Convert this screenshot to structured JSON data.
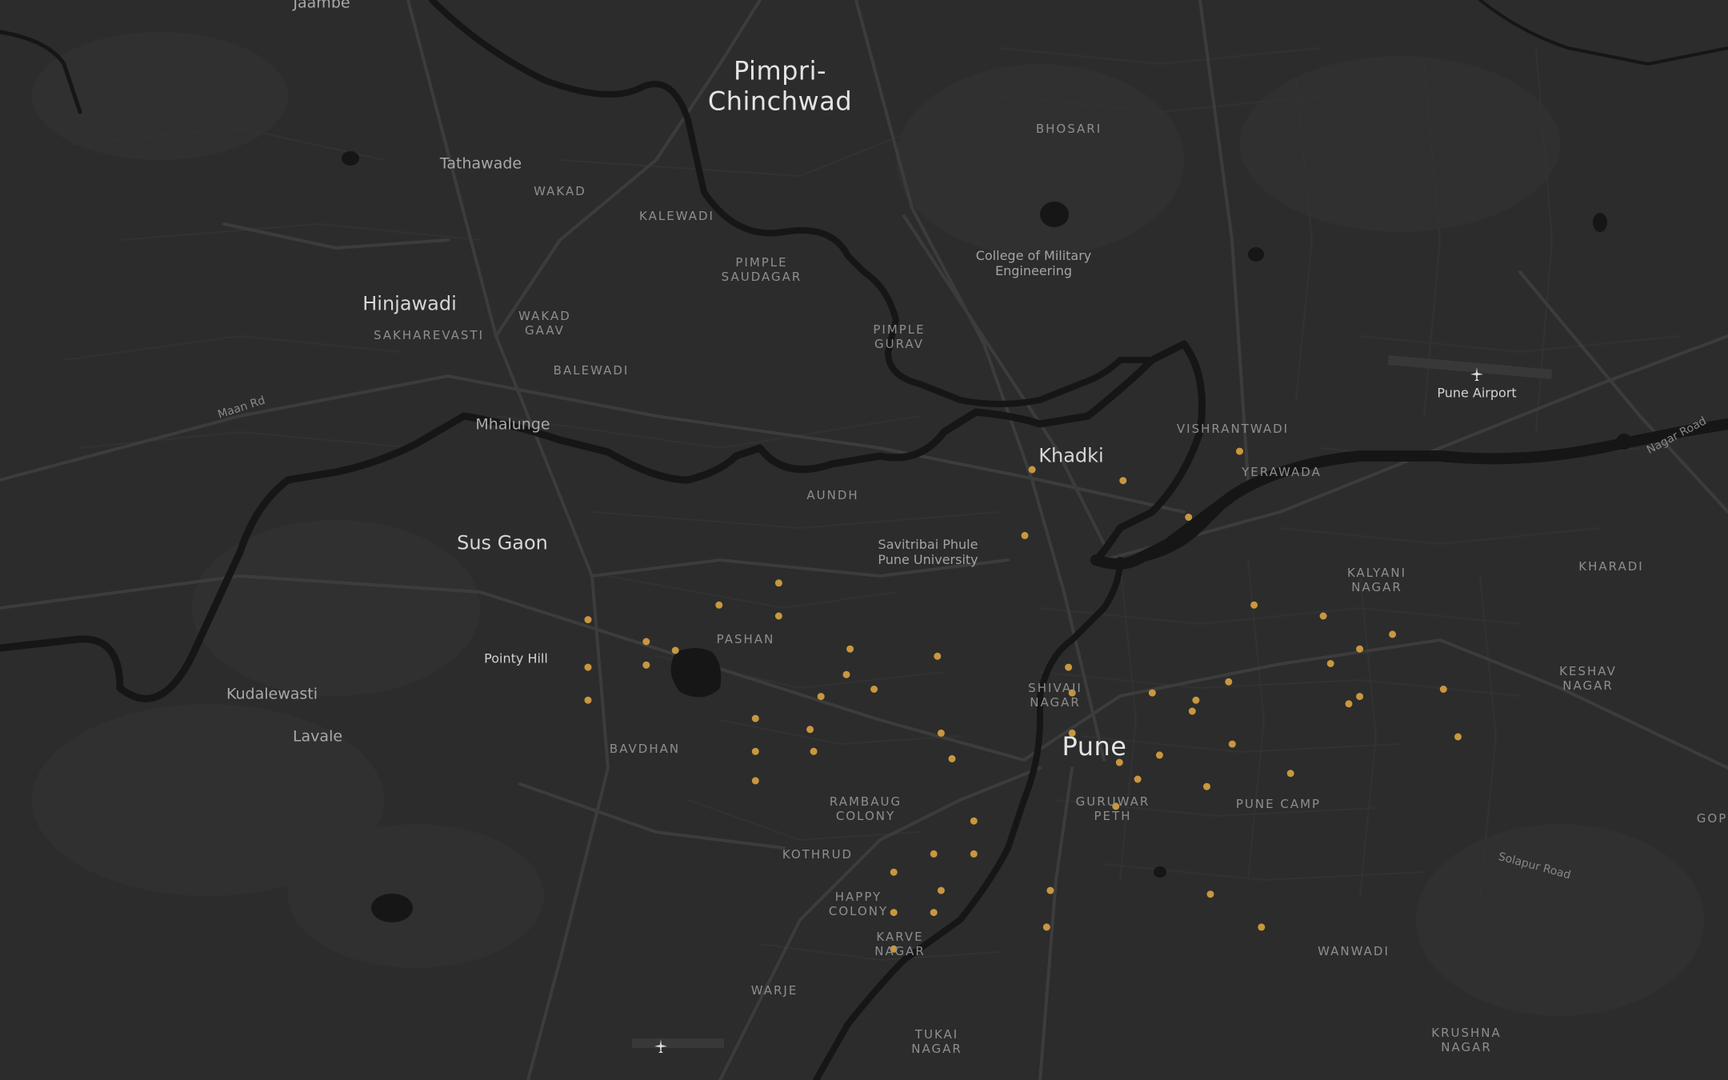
{
  "map": {
    "colors": {
      "land": "#2c2c2c",
      "water": "#161616",
      "road_major": "#3b3b3b",
      "road_minor": "#353535",
      "marker": "#c9973f"
    },
    "labels": {
      "pimpri": [
        "Pimpri-",
        "Chinchwad"
      ],
      "bhosari": "BHOSARI",
      "tathawade": "Tathawade",
      "wakad": "WAKAD",
      "kalewadi": "KALEWADI",
      "pimple_saudagar": [
        "PIMPLE",
        "SAUDAGAR"
      ],
      "cme": [
        "College of Military",
        "Engineering"
      ],
      "hinjawadi": "Hinjawadi",
      "sakharevasti": "SAKHAREVASTI",
      "wakad_gaav": [
        "WAKAD",
        "GAAV"
      ],
      "pimple_gurav": [
        "PIMPLE",
        "GURAV"
      ],
      "balewadi": "BALEWADI",
      "pune_airport": "Pune Airport",
      "maan_rd": "Maan Rd",
      "mhalunge": "Mhalunge",
      "vishrantwadi": "VISHRANTWADI",
      "khadki": "Khadki",
      "yerawada": "YERAWADA",
      "nagar_road": "Nagar Road",
      "aundh": "AUNDH",
      "sus_gaon": "Sus Gaon",
      "sppu": [
        "Savitribai Phule",
        "Pune University"
      ],
      "kalyani_nagar": [
        "KALYANI",
        "NAGAR"
      ],
      "kharadi": "KHARADI",
      "pashan": "PASHAN",
      "pointy_hill": "Pointy Hill",
      "shivaji_nagar": [
        "SHIVAJI",
        "NAGAR"
      ],
      "keshav_nagar": [
        "KESHAV",
        "NAGAR"
      ],
      "kudalewasti": "Kudalewasti",
      "lavale": "Lavale",
      "pune": "Pune",
      "bavdhan": "BAVDHAN",
      "rambaug": [
        "RAMBAUG",
        "COLONY"
      ],
      "guruwar_peth": [
        "GURUWAR",
        "PETH"
      ],
      "pune_camp": "PUNE CAMP",
      "gop": "GOP",
      "solapur_road": "Solapur Road",
      "kothrud": "KOTHRUD",
      "happy_colony": [
        "HAPPY",
        "COLONY"
      ],
      "karve_nagar": [
        "KARVE",
        "NAGAR"
      ],
      "wanwadi": "WANWADI",
      "warje": "WARJE",
      "tukai_nagar": [
        "TUKAI",
        "NAGAR"
      ],
      "krushna_nagar": [
        "KRUSHNA",
        "NAGAR"
      ],
      "jaambe": "Jaambe"
    },
    "icons": {
      "airport": "airplane-icon"
    },
    "markers": [
      {
        "lat": 18.5655,
        "lng": 73.8045
      },
      {
        "lat": 18.564,
        "lng": 73.817
      },
      {
        "lat": 18.568,
        "lng": 73.833
      },
      {
        "lat": 18.559,
        "lng": 73.826
      },
      {
        "lat": 18.5565,
        "lng": 73.8035
      },
      {
        "lat": 18.55,
        "lng": 73.7697
      },
      {
        "lat": 18.547,
        "lng": 73.7615
      },
      {
        "lat": 18.5455,
        "lng": 73.7697
      },
      {
        "lat": 18.545,
        "lng": 73.7435
      },
      {
        "lat": 18.542,
        "lng": 73.7515
      },
      {
        "lat": 18.5408,
        "lng": 73.7555
      },
      {
        "lat": 18.541,
        "lng": 73.7795
      },
      {
        "lat": 18.54,
        "lng": 73.7915
      },
      {
        "lat": 18.5385,
        "lng": 73.8095
      },
      {
        "lat": 18.547,
        "lng": 73.835
      },
      {
        "lat": 18.5455,
        "lng": 73.8445
      },
      {
        "lat": 18.543,
        "lng": 73.854
      },
      {
        "lat": 18.541,
        "lng": 73.8495
      },
      {
        "lat": 18.539,
        "lng": 73.8455
      },
      {
        "lat": 18.5365,
        "lng": 73.8315
      },
      {
        "lat": 18.5385,
        "lng": 73.7435
      },
      {
        "lat": 18.5388,
        "lng": 73.7515
      },
      {
        "lat": 18.5375,
        "lng": 73.779
      },
      {
        "lat": 18.535,
        "lng": 73.81
      },
      {
        "lat": 18.535,
        "lng": 73.821
      },
      {
        "lat": 18.534,
        "lng": 73.827
      },
      {
        "lat": 18.5325,
        "lng": 73.8265
      },
      {
        "lat": 18.5345,
        "lng": 73.8495
      },
      {
        "lat": 18.5335,
        "lng": 73.848
      },
      {
        "lat": 18.5355,
        "lng": 73.861
      },
      {
        "lat": 18.534,
        "lng": 73.7435
      },
      {
        "lat": 18.5345,
        "lng": 73.7755
      },
      {
        "lat": 18.5355,
        "lng": 73.7828
      },
      {
        "lat": 18.5315,
        "lng": 73.7665
      },
      {
        "lat": 18.53,
        "lng": 73.774
      },
      {
        "lat": 18.5295,
        "lng": 73.792
      },
      {
        "lat": 18.5295,
        "lng": 73.81
      },
      {
        "lat": 18.529,
        "lng": 73.863
      },
      {
        "lat": 18.528,
        "lng": 73.832
      },
      {
        "lat": 18.5265,
        "lng": 73.822
      },
      {
        "lat": 18.527,
        "lng": 73.7665
      },
      {
        "lat": 18.527,
        "lng": 73.7745
      },
      {
        "lat": 18.526,
        "lng": 73.7935
      },
      {
        "lat": 18.5255,
        "lng": 73.8165
      },
      {
        "lat": 18.524,
        "lng": 73.84
      },
      {
        "lat": 18.5232,
        "lng": 73.819
      },
      {
        "lat": 18.5222,
        "lng": 73.8285
      },
      {
        "lat": 18.523,
        "lng": 73.7665
      },
      {
        "lat": 18.5195,
        "lng": 73.816
      },
      {
        "lat": 18.5175,
        "lng": 73.7965
      },
      {
        "lat": 18.513,
        "lng": 73.791
      },
      {
        "lat": 18.513,
        "lng": 73.7965
      },
      {
        "lat": 18.5105,
        "lng": 73.7855
      },
      {
        "lat": 18.508,
        "lng": 73.792
      },
      {
        "lat": 18.508,
        "lng": 73.807
      },
      {
        "lat": 18.5075,
        "lng": 73.829
      },
      {
        "lat": 18.505,
        "lng": 73.7855
      },
      {
        "lat": 18.505,
        "lng": 73.791
      },
      {
        "lat": 18.503,
        "lng": 73.8065
      },
      {
        "lat": 18.503,
        "lng": 73.836
      },
      {
        "lat": 18.5,
        "lng": 73.7855
      }
    ]
  }
}
